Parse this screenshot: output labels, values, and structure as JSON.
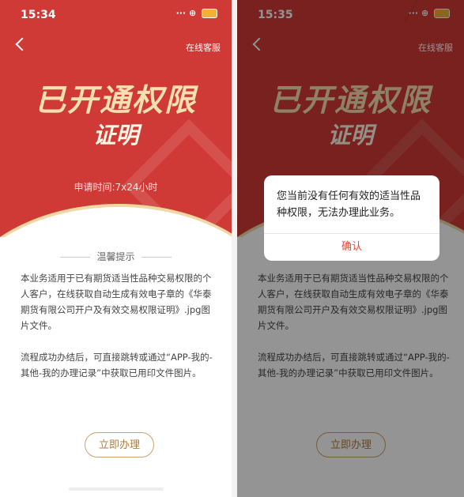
{
  "left_screen": {
    "status": {
      "time": "15:34",
      "icons": "5G"
    },
    "header": {
      "back_label": "back",
      "service_label": "在线客服"
    },
    "hero": {
      "title_line1": "已开通权限",
      "title_line2": "证明",
      "apply_time": "申请时间:7x24小时"
    },
    "tips": {
      "heading": "温馨提示",
      "paragraph1": "本业务适用于已有期货适当性品种交易权限的个人客户，在线获取自动生成有效电子章的《华泰期货有限公司开户及有效交易权限证明》.jpg图片文件。",
      "paragraph2": "流程成功办结后，可直接跳转或通过“APP-我的-其他-我的办理记录”中获取已用印文件图片。"
    },
    "action_button_label": "立即办理"
  },
  "right_screen": {
    "status": {
      "time": "15:35",
      "icons": "5G"
    },
    "header": {
      "service_label": "在线客服"
    },
    "hero": {
      "title_line1": "已开通权限",
      "title_line2": "证明"
    },
    "tips": {
      "paragraph1": "本业务适用于已有期货适当性品种交易权限的个人客户，在线获取自动生成有效电子章的《华泰期货有限公司开户及有效交易权限证明》.jpg图片文件。",
      "paragraph2": "流程成功办结后，可直接跳转或通过“APP-我的-其他-我的办理记录”中获取已用印文件图片。"
    },
    "action_button_label": "立即办理",
    "dialog": {
      "message": "您当前没有任何有效的适当性品种权限，无法办理此业务。",
      "confirm_label": "确认"
    }
  },
  "colors": {
    "brand_red": "#cf3a36",
    "gold": "#f6dfb1",
    "button_text": "#b27a37",
    "confirm_text": "#e34b3c"
  }
}
